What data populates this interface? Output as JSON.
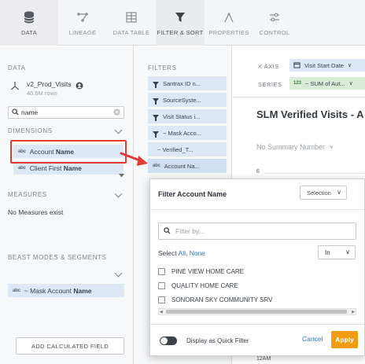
{
  "toolbar": {
    "tabs": [
      {
        "label": "DATA",
        "icon": "database-icon"
      },
      {
        "label": "LINEAGE",
        "icon": "lineage-icon"
      },
      {
        "label": "DATA TABLE",
        "icon": "table-icon"
      },
      {
        "label": "FILTER & SORT",
        "icon": "filter-icon"
      },
      {
        "label": "PROPERTIES",
        "icon": "properties-icon"
      },
      {
        "label": "CONTROL",
        "icon": "control-icon"
      }
    ],
    "active_tab": "FILTER & SORT"
  },
  "data_panel": {
    "section_label": "DATA",
    "dataset_name": "v2_Prod_Visits",
    "dataset_rows": "40.6M rows",
    "search_value": "name",
    "dimensions_label": "DIMENSIONS",
    "dimensions": [
      {
        "type": "abc",
        "name_prefix": "Account ",
        "name_bold": "Name"
      },
      {
        "type": "abc",
        "name_prefix": "Client First ",
        "name_bold": "Name"
      }
    ],
    "measures_label": "MEASURES",
    "measures_empty": "No Measures exist",
    "beast_modes_label": "BEAST MODES & SEGMENTS",
    "beast_modes": [
      {
        "type": "abc",
        "name_prefix": "~ Mask Account ",
        "name_bold": "Name"
      }
    ],
    "add_calc_label": "ADD CALCULATED FIELD"
  },
  "filters_panel": {
    "label": "FILTERS",
    "items": [
      {
        "icon": "funnel",
        "text": "Santrax ID n..."
      },
      {
        "icon": "funnel",
        "text": "SourceSyste..."
      },
      {
        "icon": "funnel",
        "text": "Visit Status i..."
      },
      {
        "icon": "funnel",
        "text": "~ Mask Acco..."
      },
      {
        "icon": "none",
        "text": "~ Verified_T..."
      },
      {
        "icon": "abc",
        "text": "Account Na..."
      }
    ]
  },
  "chart_panel": {
    "x_axis_label": "X AXIS",
    "x_axis_value": "Visit Start Date",
    "series_label": "SERIES",
    "series_type": "123",
    "series_value": "~ SUM of Aut...",
    "title": "SLM Verified Visits - A",
    "summary": "No Summary Number",
    "tick_top": "6",
    "tick_bottom": "12AM"
  },
  "filter_popup": {
    "title": "Filter Account Name",
    "mode": "Selection",
    "search_placeholder": "Filter by...",
    "select_prefix": "Select",
    "select_all": "All",
    "select_none": "None",
    "operator": "In",
    "options": [
      "PINE VIEW HOME CARE",
      "QUALITY HOME CARE",
      "SONORAN SKY COMMUNITY SRV"
    ],
    "quick_filter_label": "Display as Quick Filter",
    "cancel_label": "Cancel",
    "apply_label": "Apply"
  },
  "colors": {
    "highlight": "#e53935",
    "apply": "#f39c12",
    "pill_blue": "#dce8f5",
    "link": "#2a77c9"
  }
}
